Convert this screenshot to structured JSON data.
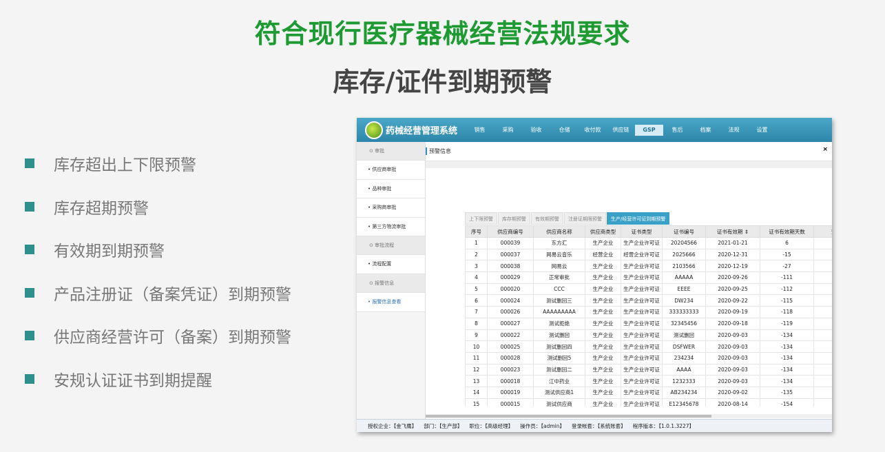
{
  "headline": "符合现行医疗器械经营法规要求",
  "subheadline": "库存/证件到期预警",
  "bullets": [
    "库存超出上下限预警",
    "库存超期预警",
    "有效期到期预警",
    "产品注册证（备案凭证）到期预警",
    "供应商经营许可（备案）到期预警",
    "安规认证证书到期提醒"
  ],
  "app": {
    "brand": "药械经营管理系统",
    "nav": [
      "销售",
      "采购",
      "验收",
      "仓储",
      "收付款",
      "供应链",
      "GSP",
      "售后",
      "档案",
      "法规",
      "设置"
    ],
    "nav_active": 6,
    "sidebar": [
      {
        "label": "审批",
        "group": true
      },
      {
        "label": "• 供应商审批"
      },
      {
        "label": "• 品种审批"
      },
      {
        "label": "• 采购商审批"
      },
      {
        "label": "• 第三方物流审批"
      },
      {
        "label": "审批流程",
        "group": true
      },
      {
        "label": "• 流程配置"
      },
      {
        "label": "报警信息",
        "group": true
      },
      {
        "label": "• 报警信息查看",
        "active": true
      }
    ],
    "breadcrumb": "预警信息",
    "close": "×",
    "tabs": [
      "上下限预警",
      "库存期预警",
      "有效期预警",
      "注册证期限预警",
      "生产/经营许可证到期预警"
    ],
    "tab_active": 4,
    "columns": [
      "序号",
      "供应商编号",
      "供应商名称",
      "供应商类型",
      "证书类型",
      "证书编号",
      "证书有效期 ⇕",
      "证书有效期天数",
      "预警"
    ],
    "rows": [
      [
        "1",
        "000039",
        "东方汇",
        "生产企业",
        "生产企业许可证",
        "20204566",
        "2021-01-21",
        "6"
      ],
      [
        "2",
        "000037",
        "网易云音乐",
        "经营企业",
        "经营企业许可证",
        "2025666",
        "2020-12-31",
        "-15"
      ],
      [
        "3",
        "000038",
        "网易云",
        "生产企业",
        "生产企业许可证",
        "2103566",
        "2020-12-19",
        "-27"
      ],
      [
        "4",
        "000029",
        "正常审批",
        "生产企业",
        "生产企业许可证",
        "AAAAA",
        "2020-09-26",
        "-111"
      ],
      [
        "5",
        "000020",
        "CCC",
        "生产企业",
        "生产企业许可证",
        "EEEE",
        "2020-09-25",
        "-112"
      ],
      [
        "6",
        "000024",
        "测试删回三",
        "生产企业",
        "生产企业许可证",
        "DW234",
        "2020-09-22",
        "-115"
      ],
      [
        "7",
        "000026",
        "AAAAAAAAA",
        "生产企业",
        "生产企业许可证",
        "333333333",
        "2020-09-19",
        "-118"
      ],
      [
        "8",
        "000027",
        "测试拒绝",
        "生产企业",
        "生产企业许可证",
        "32345456",
        "2020-09-18",
        "-119"
      ],
      [
        "9",
        "000022",
        "测试删回",
        "生产企业",
        "生产企业许可证",
        "测试删回",
        "2020-09-03",
        "-134"
      ],
      [
        "10",
        "000025",
        "测试删回四",
        "生产企业",
        "生产企业许可证",
        "DSFWER",
        "2020-09-03",
        "-134"
      ],
      [
        "11",
        "000028",
        "测试删回5",
        "生产企业",
        "生产企业许可证",
        "234234",
        "2020-09-03",
        "-134"
      ],
      [
        "12",
        "000023",
        "测试删回二",
        "生产企业",
        "生产企业许可证",
        "AAAA",
        "2020-09-03",
        "-134"
      ],
      [
        "13",
        "000018",
        "江中药业",
        "生产企业",
        "生产企业许可证",
        "1232333",
        "2020-09-03",
        "-134"
      ],
      [
        "14",
        "000019",
        "测试供应商1",
        "生产企业",
        "生产企业许可证",
        "AB234234",
        "2020-09-02",
        "-135"
      ],
      [
        "15",
        "000015",
        "测试供应商",
        "生产企业",
        "生产企业许可证",
        "E12345678",
        "2020-08-14",
        "-154"
      ]
    ],
    "status": [
      "授权企业：【金飞鹰】",
      "部门：【生产部】",
      "职位：【高级经理】",
      "操作员：【admin】",
      "登录帐套：【系统账套】",
      "程序版本：【1.0.1.3227】"
    ]
  }
}
